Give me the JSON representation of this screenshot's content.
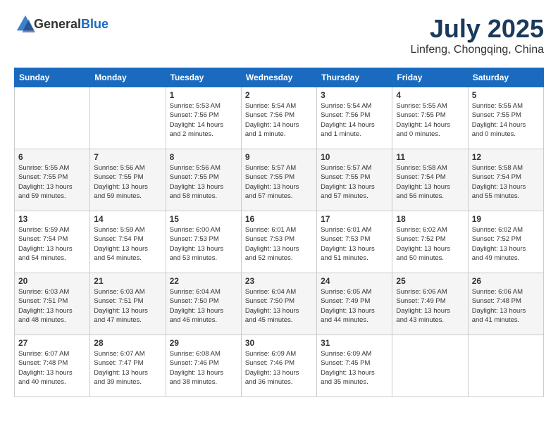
{
  "header": {
    "logo_general": "General",
    "logo_blue": "Blue",
    "month": "July 2025",
    "location": "Linfeng, Chongqing, China"
  },
  "weekdays": [
    "Sunday",
    "Monday",
    "Tuesday",
    "Wednesday",
    "Thursday",
    "Friday",
    "Saturday"
  ],
  "weeks": [
    [
      {
        "day": "",
        "info": ""
      },
      {
        "day": "",
        "info": ""
      },
      {
        "day": "1",
        "info": "Sunrise: 5:53 AM\nSunset: 7:56 PM\nDaylight: 14 hours\nand 2 minutes."
      },
      {
        "day": "2",
        "info": "Sunrise: 5:54 AM\nSunset: 7:56 PM\nDaylight: 14 hours\nand 1 minute."
      },
      {
        "day": "3",
        "info": "Sunrise: 5:54 AM\nSunset: 7:56 PM\nDaylight: 14 hours\nand 1 minute."
      },
      {
        "day": "4",
        "info": "Sunrise: 5:55 AM\nSunset: 7:55 PM\nDaylight: 14 hours\nand 0 minutes."
      },
      {
        "day": "5",
        "info": "Sunrise: 5:55 AM\nSunset: 7:55 PM\nDaylight: 14 hours\nand 0 minutes."
      }
    ],
    [
      {
        "day": "6",
        "info": "Sunrise: 5:55 AM\nSunset: 7:55 PM\nDaylight: 13 hours\nand 59 minutes."
      },
      {
        "day": "7",
        "info": "Sunrise: 5:56 AM\nSunset: 7:55 PM\nDaylight: 13 hours\nand 59 minutes."
      },
      {
        "day": "8",
        "info": "Sunrise: 5:56 AM\nSunset: 7:55 PM\nDaylight: 13 hours\nand 58 minutes."
      },
      {
        "day": "9",
        "info": "Sunrise: 5:57 AM\nSunset: 7:55 PM\nDaylight: 13 hours\nand 57 minutes."
      },
      {
        "day": "10",
        "info": "Sunrise: 5:57 AM\nSunset: 7:55 PM\nDaylight: 13 hours\nand 57 minutes."
      },
      {
        "day": "11",
        "info": "Sunrise: 5:58 AM\nSunset: 7:54 PM\nDaylight: 13 hours\nand 56 minutes."
      },
      {
        "day": "12",
        "info": "Sunrise: 5:58 AM\nSunset: 7:54 PM\nDaylight: 13 hours\nand 55 minutes."
      }
    ],
    [
      {
        "day": "13",
        "info": "Sunrise: 5:59 AM\nSunset: 7:54 PM\nDaylight: 13 hours\nand 54 minutes."
      },
      {
        "day": "14",
        "info": "Sunrise: 5:59 AM\nSunset: 7:54 PM\nDaylight: 13 hours\nand 54 minutes."
      },
      {
        "day": "15",
        "info": "Sunrise: 6:00 AM\nSunset: 7:53 PM\nDaylight: 13 hours\nand 53 minutes."
      },
      {
        "day": "16",
        "info": "Sunrise: 6:01 AM\nSunset: 7:53 PM\nDaylight: 13 hours\nand 52 minutes."
      },
      {
        "day": "17",
        "info": "Sunrise: 6:01 AM\nSunset: 7:53 PM\nDaylight: 13 hours\nand 51 minutes."
      },
      {
        "day": "18",
        "info": "Sunrise: 6:02 AM\nSunset: 7:52 PM\nDaylight: 13 hours\nand 50 minutes."
      },
      {
        "day": "19",
        "info": "Sunrise: 6:02 AM\nSunset: 7:52 PM\nDaylight: 13 hours\nand 49 minutes."
      }
    ],
    [
      {
        "day": "20",
        "info": "Sunrise: 6:03 AM\nSunset: 7:51 PM\nDaylight: 13 hours\nand 48 minutes."
      },
      {
        "day": "21",
        "info": "Sunrise: 6:03 AM\nSunset: 7:51 PM\nDaylight: 13 hours\nand 47 minutes."
      },
      {
        "day": "22",
        "info": "Sunrise: 6:04 AM\nSunset: 7:50 PM\nDaylight: 13 hours\nand 46 minutes."
      },
      {
        "day": "23",
        "info": "Sunrise: 6:04 AM\nSunset: 7:50 PM\nDaylight: 13 hours\nand 45 minutes."
      },
      {
        "day": "24",
        "info": "Sunrise: 6:05 AM\nSunset: 7:49 PM\nDaylight: 13 hours\nand 44 minutes."
      },
      {
        "day": "25",
        "info": "Sunrise: 6:06 AM\nSunset: 7:49 PM\nDaylight: 13 hours\nand 43 minutes."
      },
      {
        "day": "26",
        "info": "Sunrise: 6:06 AM\nSunset: 7:48 PM\nDaylight: 13 hours\nand 41 minutes."
      }
    ],
    [
      {
        "day": "27",
        "info": "Sunrise: 6:07 AM\nSunset: 7:48 PM\nDaylight: 13 hours\nand 40 minutes."
      },
      {
        "day": "28",
        "info": "Sunrise: 6:07 AM\nSunset: 7:47 PM\nDaylight: 13 hours\nand 39 minutes."
      },
      {
        "day": "29",
        "info": "Sunrise: 6:08 AM\nSunset: 7:46 PM\nDaylight: 13 hours\nand 38 minutes."
      },
      {
        "day": "30",
        "info": "Sunrise: 6:09 AM\nSunset: 7:46 PM\nDaylight: 13 hours\nand 36 minutes."
      },
      {
        "day": "31",
        "info": "Sunrise: 6:09 AM\nSunset: 7:45 PM\nDaylight: 13 hours\nand 35 minutes."
      },
      {
        "day": "",
        "info": ""
      },
      {
        "day": "",
        "info": ""
      }
    ]
  ]
}
